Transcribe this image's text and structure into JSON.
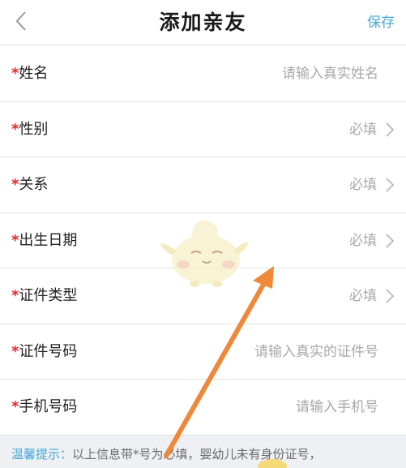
{
  "header": {
    "title": "添加亲友",
    "save_label": "保存",
    "back_icon": "chevron-left-icon"
  },
  "form": {
    "required_mark": "*",
    "rows": [
      {
        "label": "姓名",
        "value": "请输入真实姓名",
        "kind": "input"
      },
      {
        "label": "性别",
        "value": "必填",
        "kind": "select"
      },
      {
        "label": "关系",
        "value": "必填",
        "kind": "select"
      },
      {
        "label": "出生日期",
        "value": "必填",
        "kind": "select"
      },
      {
        "label": "证件类型",
        "value": "必填",
        "kind": "select"
      },
      {
        "label": "证件号码",
        "value": "请输入真实的证件号",
        "kind": "input"
      },
      {
        "label": "手机号码",
        "value": "请输入手机号",
        "kind": "input"
      }
    ]
  },
  "tip": {
    "lead": "温馨提示：",
    "text": "以上信息带*号为必填，婴幼儿未有身份证号，"
  },
  "colors": {
    "accent": "#45a8d8",
    "required": "#e02a2a",
    "placeholder": "#a8a8a8",
    "arrow": "#f0883a"
  }
}
